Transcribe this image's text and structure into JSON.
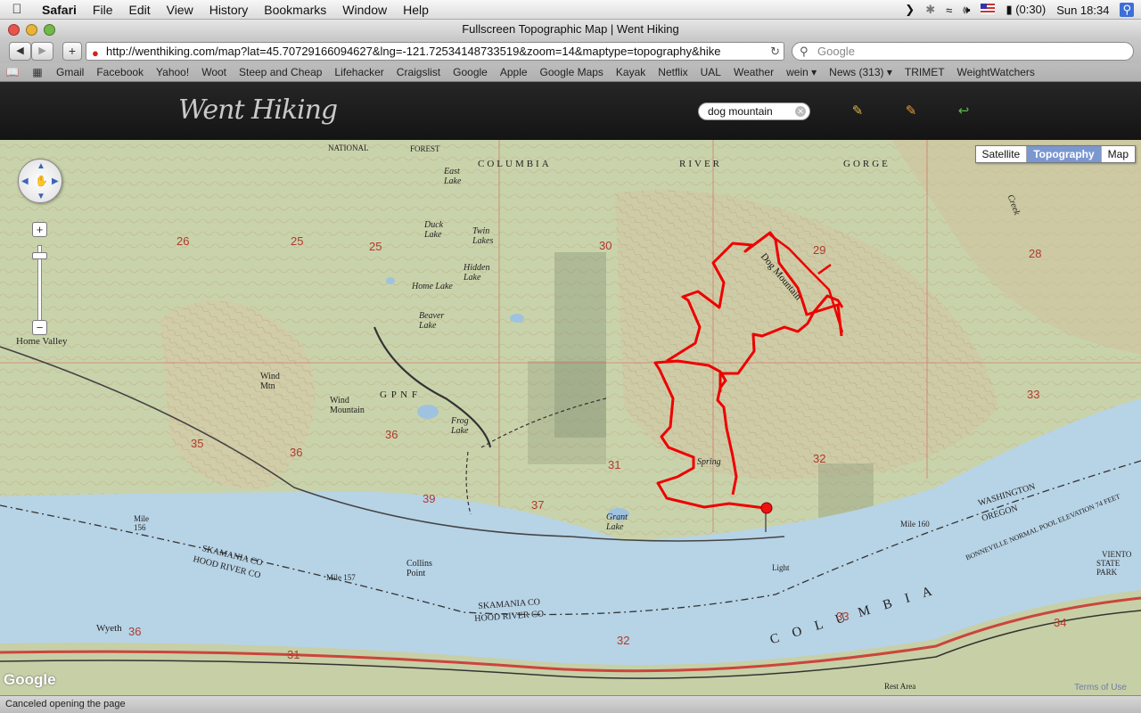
{
  "menubar": {
    "app_name": "Safari",
    "items": [
      "File",
      "Edit",
      "View",
      "History",
      "Bookmarks",
      "Window",
      "Help"
    ],
    "battery": "(0:30)",
    "clock": "Sun 18:34"
  },
  "window": {
    "title": "Fullscreen Topographic Map | Went Hiking"
  },
  "toolbar": {
    "url": "http://wenthiking.com/map?lat=45.70729166094627&lng=-121.72534148733519&zoom=14&maptype=topography&hike",
    "search_placeholder": "Google"
  },
  "bookmarks": [
    "Gmail",
    "Facebook",
    "Yahoo!",
    "Woot",
    "Steep and Cheap",
    "Lifehacker",
    "Craigslist",
    "Google",
    "Apple",
    "Google Maps",
    "Kayak",
    "Netflix",
    "UAL",
    "Weather",
    "wein ▾",
    "News (313) ▾",
    "TRIMET",
    "WeightWatchers"
  ],
  "site": {
    "logo": "Went Hiking",
    "search_value": "dog mountain"
  },
  "map": {
    "types": [
      "Satellite",
      "Topography",
      "Map"
    ],
    "selected_type": "Topography",
    "labels": {
      "columbia_top": "COLUMBIA",
      "river_top": "RIVER",
      "gorge_top": "GORGE",
      "national": "NATIONAL",
      "forest": "FOREST",
      "east_lake": "East Lake",
      "duck_lake": "Duck Lake",
      "twin_lakes": "Twin Lakes",
      "hidden_lake": "Hidden Lake",
      "home_lake": "Home Lake",
      "beaver_lake": "Beaver Lake",
      "frog_lake": "Frog Lake",
      "wind_mountain": "Wind Mountain",
      "wind_mtn": "Wind Mtn",
      "home_valley": "Home Valley",
      "dog_mountain": "Dog Mountain",
      "spring": "Spring",
      "grant_lake": "Grant Lake",
      "collins_point": "Collins Point",
      "skamania_co": "SKAMANIA CO",
      "hood_river_co": "HOOD RIVER CO",
      "washington": "WASHINGTON",
      "oregon": "OREGON",
      "bonneville": "BONNEVILLE NORMAL POOL ELEVATION 74 FEET",
      "columbia_river": "C O L U M B I A",
      "viento": "VIENTO",
      "state_park": "STATE PARK",
      "mile_156": "Mile 156",
      "mile_157": "Mile 157",
      "mile_160": "Mile 160",
      "wyeth": "Wyeth",
      "light": "Light",
      "gpnf": "G P N F",
      "creek": "Creek",
      "rest_area": "Rest Area",
      "section_25": "25",
      "section_26": "26",
      "section_29": "29",
      "section_28": "28",
      "section_30": "30",
      "section_31": "31",
      "section_32": "32",
      "section_33": "33",
      "section_34": "34",
      "section_35": "35",
      "section_36": "36",
      "section_37": "37",
      "section_39": "39"
    },
    "google": "Google",
    "terms": "Terms of Use"
  },
  "status": "Canceled opening the page",
  "colors": {
    "trail": "#ee0000",
    "water": "#b7d3e6",
    "land": "#c8d2a9",
    "header": "#1c1c1c"
  }
}
